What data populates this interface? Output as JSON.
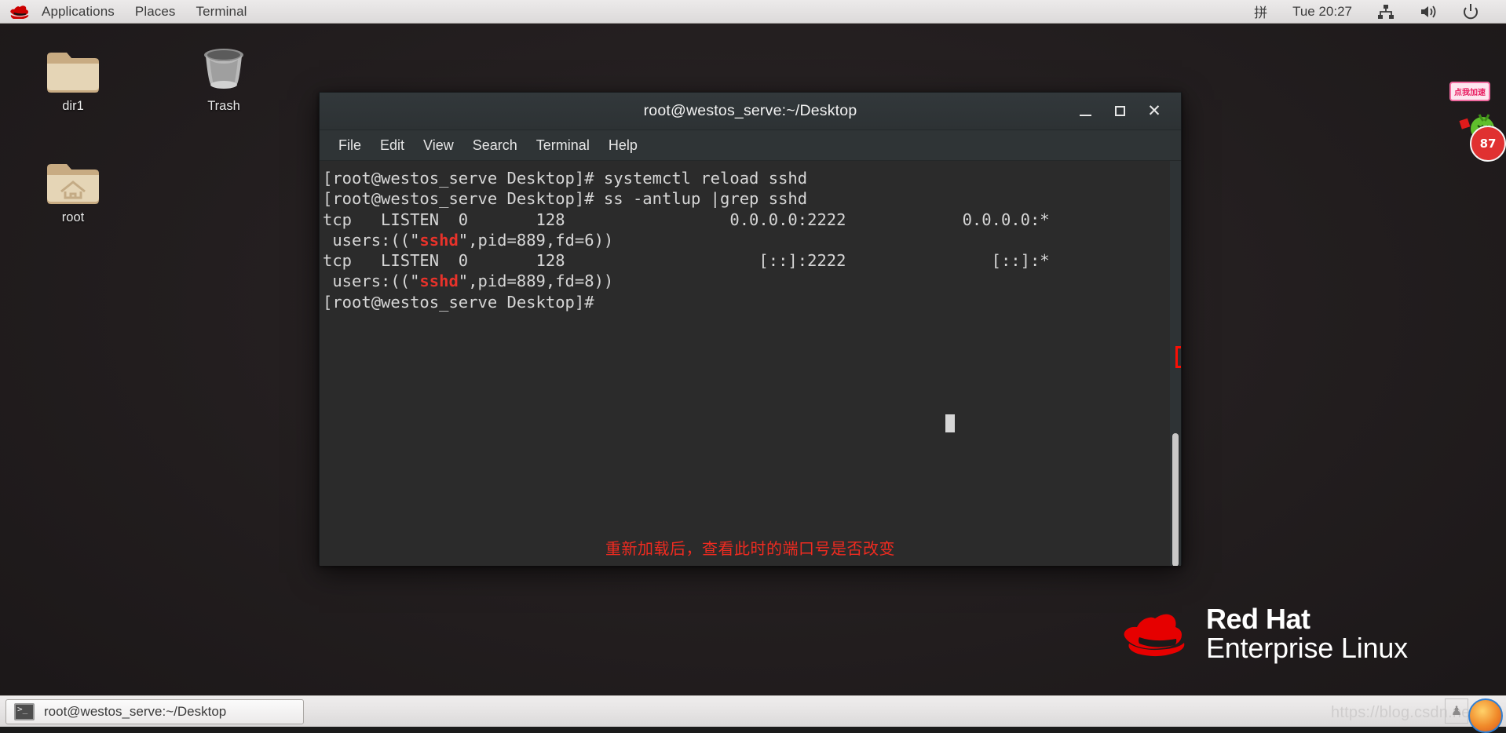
{
  "top_panel": {
    "logo_icon": "redhat-fedora-icon",
    "menus": [
      "Applications",
      "Places",
      "Terminal"
    ],
    "ime_indicator": "拼",
    "clock": "Tue 20:27",
    "tray_icons": [
      "network-icon",
      "volume-icon",
      "power-icon"
    ]
  },
  "desktop": {
    "icons": [
      {
        "label": "dir1",
        "icon": "folder-icon"
      },
      {
        "label": "Trash",
        "icon": "trash-icon"
      },
      {
        "label": "root",
        "icon": "home-folder-icon"
      }
    ],
    "brand": {
      "icon": "redhat-fedora-logo",
      "line1": "Red Hat",
      "line2": "Enterprise Linux"
    },
    "widget": {
      "bubble_text": "点我加速",
      "badge_value": "87"
    }
  },
  "terminal": {
    "title": "root@westos_serve:~/Desktop",
    "menus": [
      "File",
      "Edit",
      "View",
      "Search",
      "Terminal",
      "Help"
    ],
    "window_buttons": [
      "minimize",
      "maximize",
      "close"
    ],
    "prompt": "[root@westos_serve Desktop]#",
    "lines": [
      {
        "text": "[root@westos_serve Desktop]# systemctl reload sshd"
      },
      {
        "text": "[root@westos_serve Desktop]# ss -antlup |grep sshd"
      },
      {
        "text": "tcp   LISTEN  0       128                 0.0.0.0:2222            0.0.0.0:*"
      },
      {
        "text": " users:((\"sshd\",pid=889,fd=6))",
        "grep": "sshd"
      },
      {
        "text": "tcp   LISTEN  0       128                    [::]:2222               [::]:*"
      },
      {
        "text": " users:((\"sshd\",pid=889,fd=8))",
        "grep": "sshd"
      },
      {
        "text": "[root@westos_serve Desktop]# "
      }
    ],
    "highlight_box": {
      "value": "2222",
      "color": "#fb0f05"
    },
    "annotation": "重新加载后，查看此时的端口号是否改变",
    "annotation_color": "#ef2b20",
    "commands": [
      "systemctl reload sshd",
      "ss -antlup |grep sshd"
    ],
    "listening_ports": [
      {
        "proto": "tcp",
        "state": "LISTEN",
        "recvq": "0",
        "sendq": "128",
        "local": "0.0.0.0:2222",
        "peer": "0.0.0.0:*",
        "users": "users:((\"sshd\",pid=889,fd=6))"
      },
      {
        "proto": "tcp",
        "state": "LISTEN",
        "recvq": "0",
        "sendq": "128",
        "local": "[::]:2222",
        "peer": "[::]:*",
        "users": "users:((\"sshd\",pid=889,fd=8))"
      }
    ]
  },
  "taskbar": {
    "window_label": "root@westos_serve:~/Desktop",
    "window_icon": "terminal-icon",
    "watermark": "https://blog.csdn.net/"
  }
}
